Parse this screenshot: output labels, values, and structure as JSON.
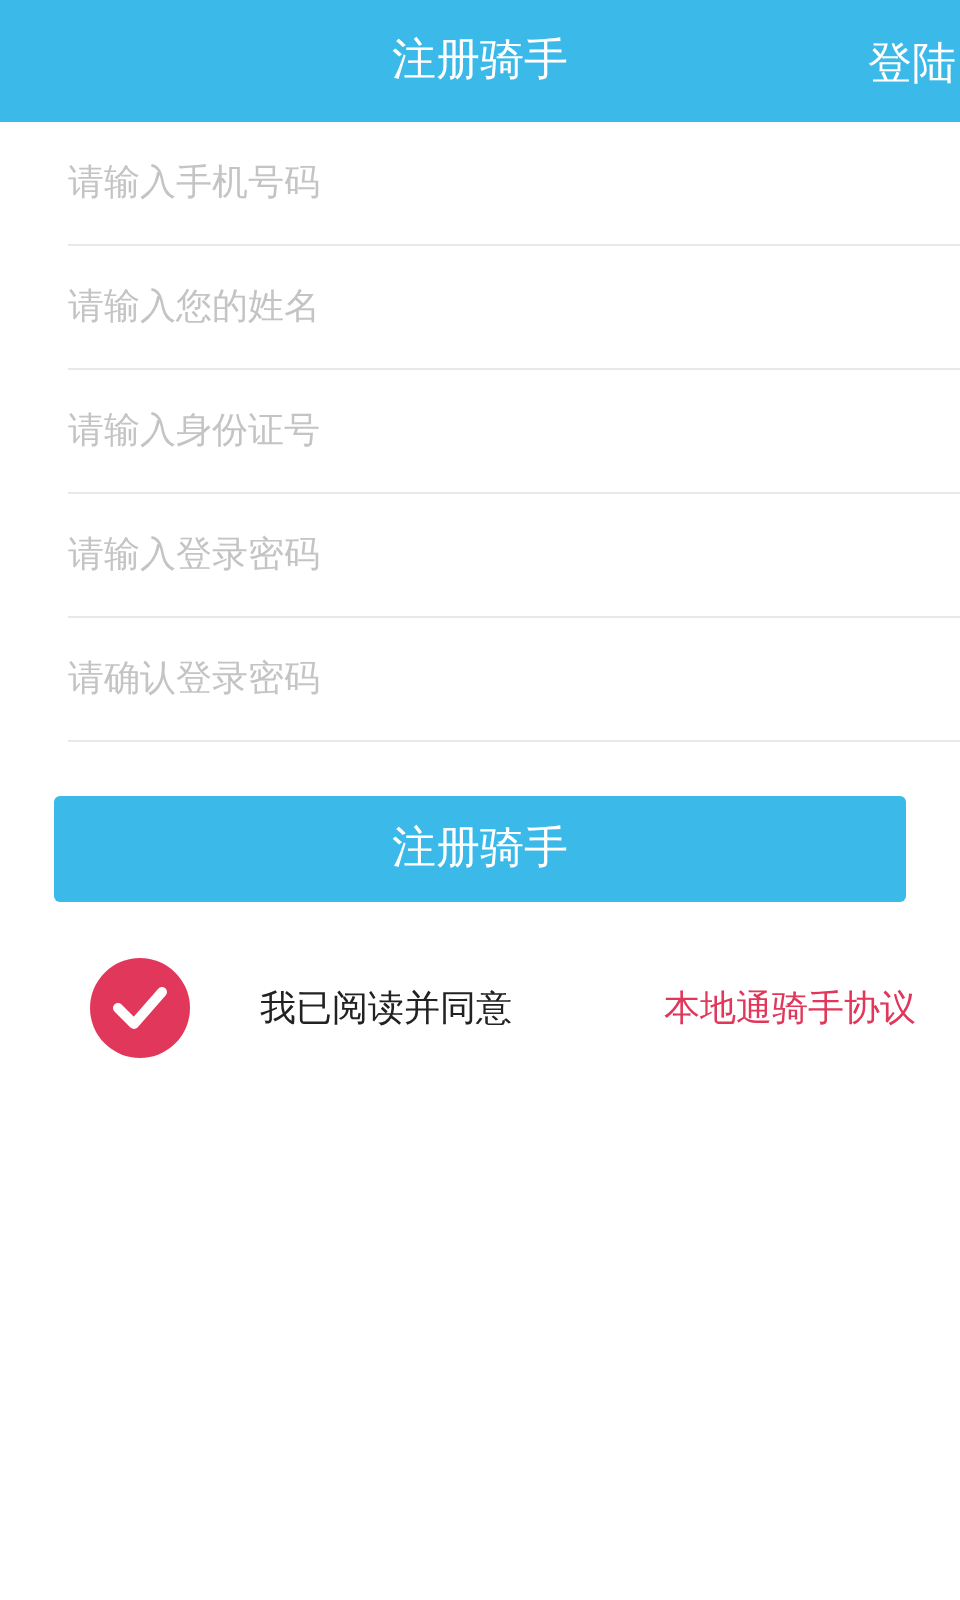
{
  "header": {
    "title": "注册骑手",
    "login_link": "登陆"
  },
  "fields": [
    {
      "placeholder": "请输入手机号码"
    },
    {
      "placeholder": "请输入您的姓名"
    },
    {
      "placeholder": "请输入身份证号"
    },
    {
      "placeholder": "请输入登录密码"
    },
    {
      "placeholder": "请确认登录密码"
    }
  ],
  "submit_button": "注册骑手",
  "agreement": {
    "checked": true,
    "text": "我已阅读并同意",
    "link": "本地通骑手协议"
  }
}
